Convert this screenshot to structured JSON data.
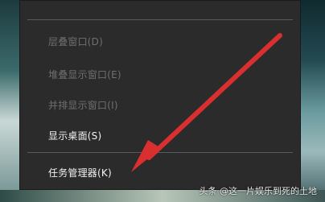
{
  "context_menu": {
    "items": [
      {
        "label": "层叠窗口(D)",
        "enabled": false
      },
      {
        "label": "堆叠显示窗口(E)",
        "enabled": false
      },
      {
        "label": "并排显示窗口(I)",
        "enabled": false
      },
      {
        "label": "显示桌面(S)",
        "enabled": true
      },
      {
        "label": "任务管理器(K)",
        "enabled": true
      }
    ]
  },
  "annotation": {
    "arrow_color": "#d9302f"
  },
  "watermark": {
    "text": "头条 @这一片娱乐到死的土地"
  }
}
